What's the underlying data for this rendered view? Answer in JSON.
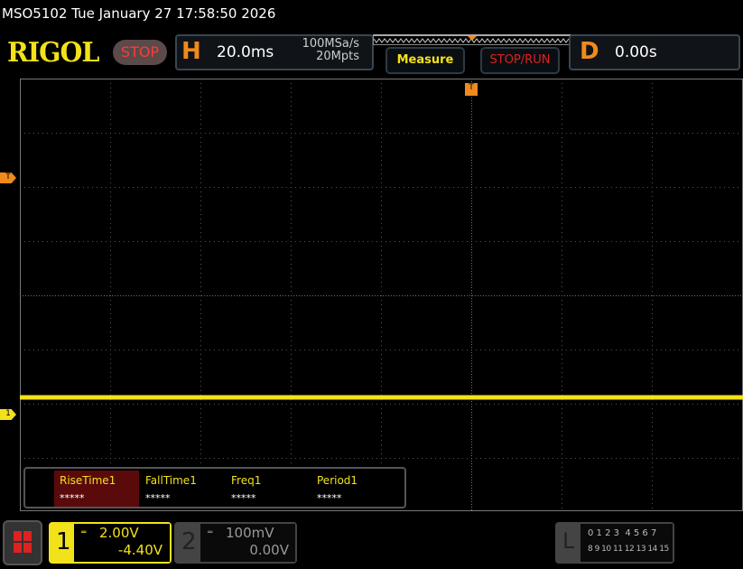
{
  "title": "MSO5102  Tue January 27 17:58:50 2026",
  "logo": "RIGOL",
  "run_state": "STOP",
  "horizontal": {
    "letter": "H",
    "timebase": "20.0ms",
    "sample_rate": "100MSa/s",
    "memory_depth": "20Mpts"
  },
  "buttons": {
    "measure": "Measure",
    "stop_run": "STOP/RUN"
  },
  "delay": {
    "letter": "D",
    "value": "0.00s"
  },
  "markers": {
    "trigger": "T",
    "trigger_level": "T",
    "channel1": "1"
  },
  "measurements": [
    {
      "label": "RiseTime1",
      "value": "*****",
      "selected": true
    },
    {
      "label": "FallTime1",
      "value": "*****"
    },
    {
      "label": "Freq1",
      "value": "*****"
    },
    {
      "label": "Period1",
      "value": "*****"
    }
  ],
  "channels": [
    {
      "number": "1",
      "scale": "2.00V",
      "offset": "-4.40V",
      "color": "#f2e21a",
      "coupling": "dc-coupling-icon"
    },
    {
      "number": "2",
      "scale": "100mV",
      "offset": "0.00V",
      "color": "#888888",
      "coupling": "dc-coupling-icon"
    }
  ],
  "logic": {
    "letter": "L",
    "row1": "0 1 2 3  4 5 6 7",
    "row2": "8 9 10 11 12 13 14 15"
  },
  "colors": {
    "trace": "#f2e21a",
    "accent": "#f08a1c",
    "stop": "#ff3a3a"
  }
}
